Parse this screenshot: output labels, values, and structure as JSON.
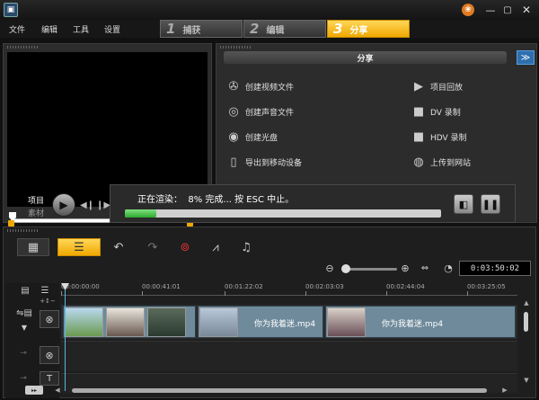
{
  "menu": {
    "file": "文件",
    "edit": "编辑",
    "tools": "工具",
    "settings": "设置"
  },
  "steps": [
    {
      "num": "1",
      "label": "捕获"
    },
    {
      "num": "2",
      "label": "编辑"
    },
    {
      "num": "3",
      "label": "分享"
    }
  ],
  "active_step": 3,
  "share": {
    "header": "分享",
    "options_left": [
      {
        "label": "创建视频文件",
        "icon": "film-reel-icon"
      },
      {
        "label": "创建声音文件",
        "icon": "audio-file-icon"
      },
      {
        "label": "创建光盘",
        "icon": "disc-icon"
      },
      {
        "label": "导出到移动设备",
        "icon": "mobile-device-icon"
      }
    ],
    "options_right": [
      {
        "label": "项目回放",
        "icon": "playback-icon"
      },
      {
        "label": "DV 录制",
        "icon": "dv-camera-icon"
      },
      {
        "label": "HDV 录制",
        "icon": "hdv-camera-icon"
      },
      {
        "label": "上传到网站",
        "icon": "globe-icon"
      }
    ]
  },
  "render": {
    "status": "正在渲染：  8% 完成... 按 ESC 中止。",
    "progress": 0.08
  },
  "preview": {
    "mode_project": "项目",
    "mode_clip": "素材"
  },
  "timeline": {
    "timecode": "0:03:50:02",
    "ruler_ticks": [
      "00:00:00:00",
      "00:00:41:01",
      "00:01:22:02",
      "00:02:03:03",
      "00:02:44:04",
      "00:03:25:05"
    ],
    "clips": [
      {
        "title": "",
        "kind": "thumbs"
      },
      {
        "title": "你为我着迷.mp4",
        "kind": "titled"
      },
      {
        "title": "你为我着迷.mp4",
        "kind": "titled"
      }
    ]
  },
  "colors": {
    "accent": "#f0a800",
    "progress": "#2fa82f",
    "clip": "#6e8a9b"
  }
}
